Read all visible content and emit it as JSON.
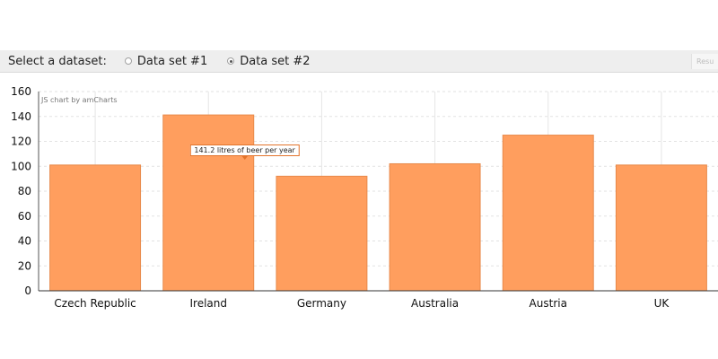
{
  "toolbar": {
    "label": "Select a dataset:",
    "options": [
      {
        "label": "Data set #1",
        "checked": false
      },
      {
        "label": "Data set #2",
        "checked": true
      }
    ],
    "result_tab": "Resu"
  },
  "chart_data": {
    "type": "bar",
    "categories": [
      "Czech Republic",
      "Ireland",
      "Germany",
      "Australia",
      "Austria",
      "UK"
    ],
    "values": [
      101,
      141.2,
      92,
      102,
      125,
      101
    ],
    "ylim": [
      0,
      160
    ],
    "yticks": [
      0,
      20,
      40,
      60,
      80,
      100,
      120,
      140,
      160
    ],
    "grid": true,
    "bar_color": "#ff9e5e",
    "bar_border_color": "#e8894a",
    "credit": "JS chart by amCharts",
    "tooltip": {
      "category": "Ireland",
      "text": "141.2 litres of beer per year"
    }
  }
}
